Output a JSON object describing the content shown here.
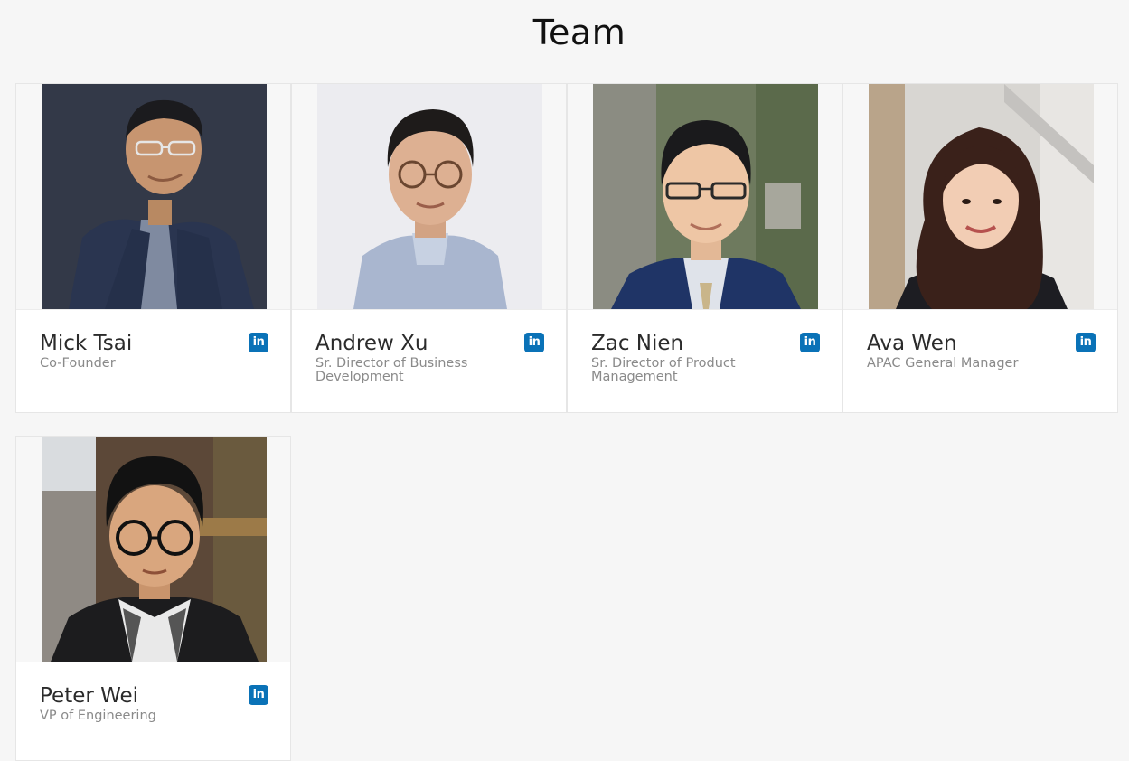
{
  "page": {
    "title": "Team"
  },
  "colors": {
    "background": "#f6f6f6",
    "card": "#ffffff",
    "linkedin_blue": "#0a72b7",
    "name_text": "#2b2b2b",
    "role_text": "#8a8a8a"
  },
  "linkedin_icon_text": "in",
  "members": [
    {
      "name": "Mick Tsai",
      "role": "Co-Founder",
      "icon": "linkedin-icon"
    },
    {
      "name": "Andrew Xu",
      "role": "Sr. Director of Business Development",
      "icon": "linkedin-icon"
    },
    {
      "name": "Zac Nien",
      "role": "Sr. Director of Product Management",
      "icon": "linkedin-icon"
    },
    {
      "name": "Ava Wen",
      "role": "APAC General Manager",
      "icon": "linkedin-icon"
    },
    {
      "name": "Peter Wei",
      "role": "VP of Engineering",
      "icon": "linkedin-icon"
    }
  ]
}
